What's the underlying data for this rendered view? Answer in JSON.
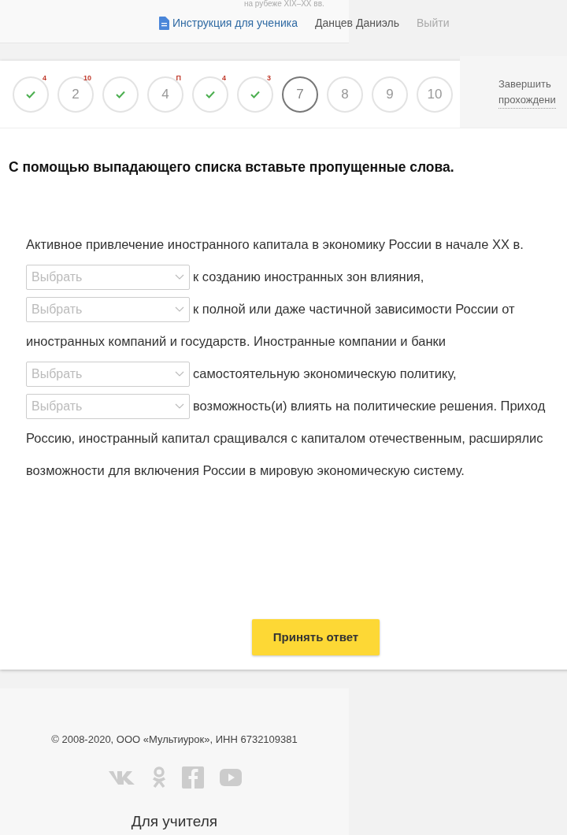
{
  "header": {
    "subtitle": "на рубеже XIX–XX вв.",
    "instruction_link": "Инструкция для ученика",
    "user_name": "Данцев Даниэль",
    "logout": "Выйти"
  },
  "steps": [
    {
      "kind": "done",
      "badge": "4",
      "selected": false
    },
    {
      "kind": "number",
      "label": "2",
      "badge": "10",
      "selected": false
    },
    {
      "kind": "done",
      "selected": false
    },
    {
      "kind": "number",
      "label": "4",
      "badge": "П",
      "selected": false
    },
    {
      "kind": "done",
      "badge": "4",
      "selected": false
    },
    {
      "kind": "done",
      "badge": "3",
      "selected": false
    },
    {
      "kind": "number",
      "label": "7",
      "selected": true
    },
    {
      "kind": "number",
      "label": "8",
      "selected": false
    },
    {
      "kind": "number",
      "label": "9",
      "selected": false
    },
    {
      "kind": "number",
      "label": "10",
      "selected": false
    }
  ],
  "finish": [
    "Завершить",
    "прохождени"
  ],
  "task": {
    "instruction": "С помощью выпадающего списка вставьте пропущенные слова.",
    "lines": [
      [
        {
          "kind": "text",
          "text": "Активное привлечение иностранного капитала в экономику России в начале XX в."
        }
      ],
      [
        {
          "kind": "select",
          "placeholder": "Выбрать"
        },
        {
          "kind": "text",
          "text": "к созданию иностранных зон влияния,"
        }
      ],
      [
        {
          "kind": "select",
          "placeholder": "Выбрать"
        },
        {
          "kind": "text",
          "text": "к полной или даже частичной зависимости России от"
        }
      ],
      [
        {
          "kind": "text",
          "text": "иностранных компаний и государств. Иностранные компании и банки"
        }
      ],
      [
        {
          "kind": "select",
          "placeholder": "Выбрать"
        },
        {
          "kind": "text",
          "text": "самостоятельную экономическую политику,"
        }
      ],
      [
        {
          "kind": "select",
          "placeholder": "Выбрать"
        },
        {
          "kind": "text",
          "text": "возможность(и) влиять на политические решения. Приход"
        }
      ],
      [
        {
          "kind": "text",
          "text": "Россию, иностранный капитал сращивался с капиталом отечественным, расширялис"
        }
      ],
      [
        {
          "kind": "text",
          "text": "возможности для включения России в мировую экономическую систему."
        }
      ]
    ],
    "submit": "Принять ответ"
  },
  "footer": {
    "copyright": "© 2008-2020, ООО «Мультиурок», ИНН 6732109381",
    "teacher_link": "Для учителя"
  }
}
